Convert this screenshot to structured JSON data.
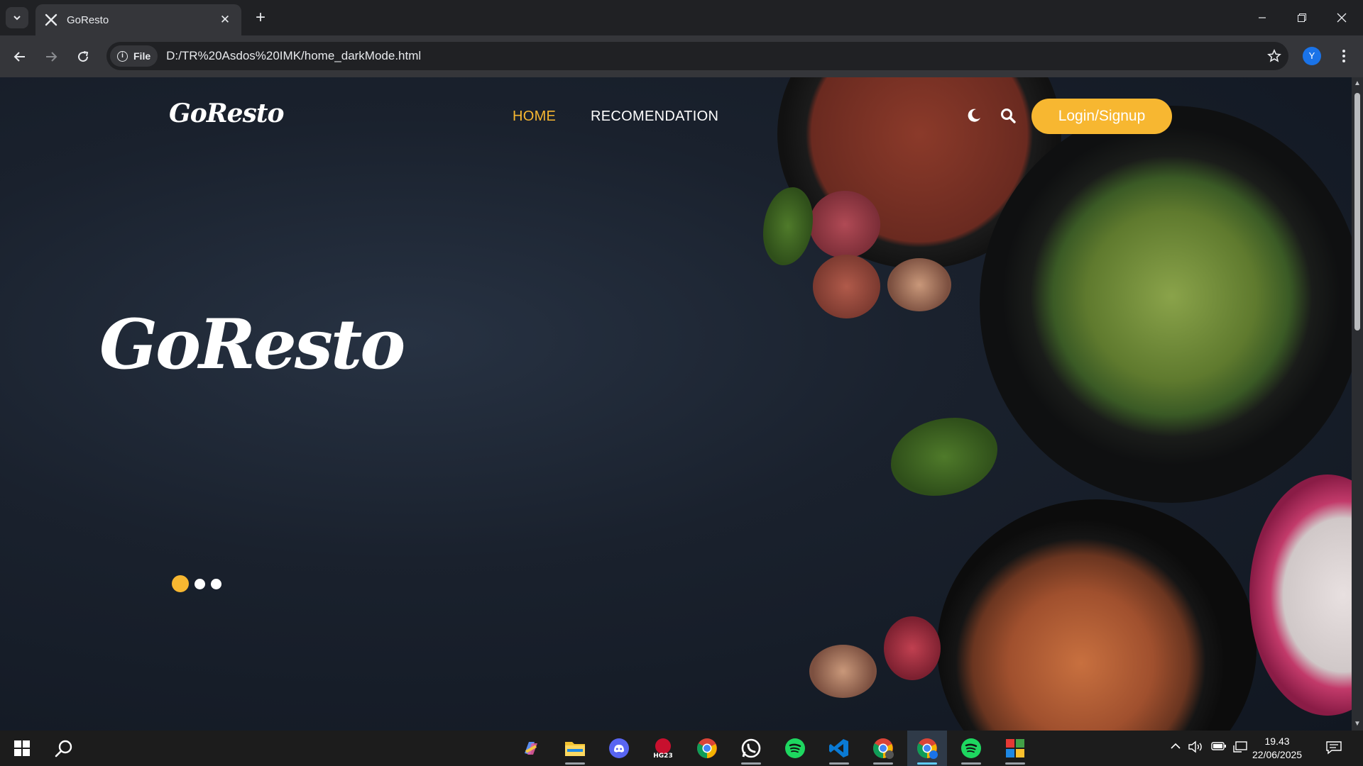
{
  "browser": {
    "tab_title": "GoResto",
    "new_tab_symbol": "+",
    "close_symbol": "✕",
    "chip_label": "File",
    "url": "D:/TR%20Asdos%20IMK/home_darkMode.html",
    "profile_initial": "Y"
  },
  "site": {
    "brand": "GoResto",
    "nav": [
      "HOME",
      "RECOMENDATION"
    ],
    "login_label": "Login/Signup",
    "hero_title": "GoResto",
    "slider": {
      "count": 3,
      "active_index": 0
    },
    "accent_color": "#f7b731"
  },
  "taskbar": {
    "apps": [
      "copilot-icon",
      "file-explorer-icon",
      "discord-icon",
      "hg23-icon",
      "chrome-icon",
      "whatsapp-icon",
      "spotify-icon",
      "vscode-icon",
      "chrome-profile-icon",
      "chrome-active-icon",
      "spotify-icon-2",
      "winrar-icon"
    ],
    "hg_label": "HG23",
    "time": "19.43",
    "date": "22/06/2025"
  }
}
